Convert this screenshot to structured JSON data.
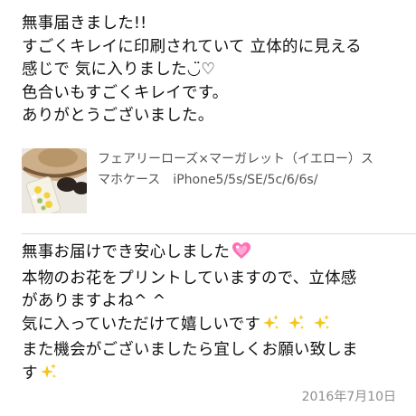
{
  "review": {
    "lines": [
      "無事届きました!!",
      "すごくキレイに印刷されていて 立体的に見える",
      "感じで 気に入りました◡̈♡",
      "色合いもすごくキレイです。",
      "ありがとうございました。"
    ]
  },
  "product": {
    "name_line1": "フェアリーローズ×マーガレット（イエロー）ス",
    "name_line2": "マホケース　iPhone5/5s/SE/5c/6/6s/"
  },
  "reply": {
    "line1": "無事お届けでき安心しました",
    "line2": "本物のお花をプリントしていますので、立体感",
    "line3": "がありますよね^ ^",
    "line4": "気に入っていただけて嬉しいです",
    "line5": "また機会がございましたら宜しくお願い致しま",
    "line6": "す",
    "icons": {
      "heart": "sparkling-heart-icon",
      "sparkles": "sparkles-icon"
    }
  },
  "date": "2016年7月10日",
  "colors": {
    "text": "#111111",
    "product_text": "#555555",
    "date_text": "#8e8e8e",
    "divider": "#d9d9d9",
    "heart": "#ff6fb5",
    "sparkles": "#f5c518"
  }
}
